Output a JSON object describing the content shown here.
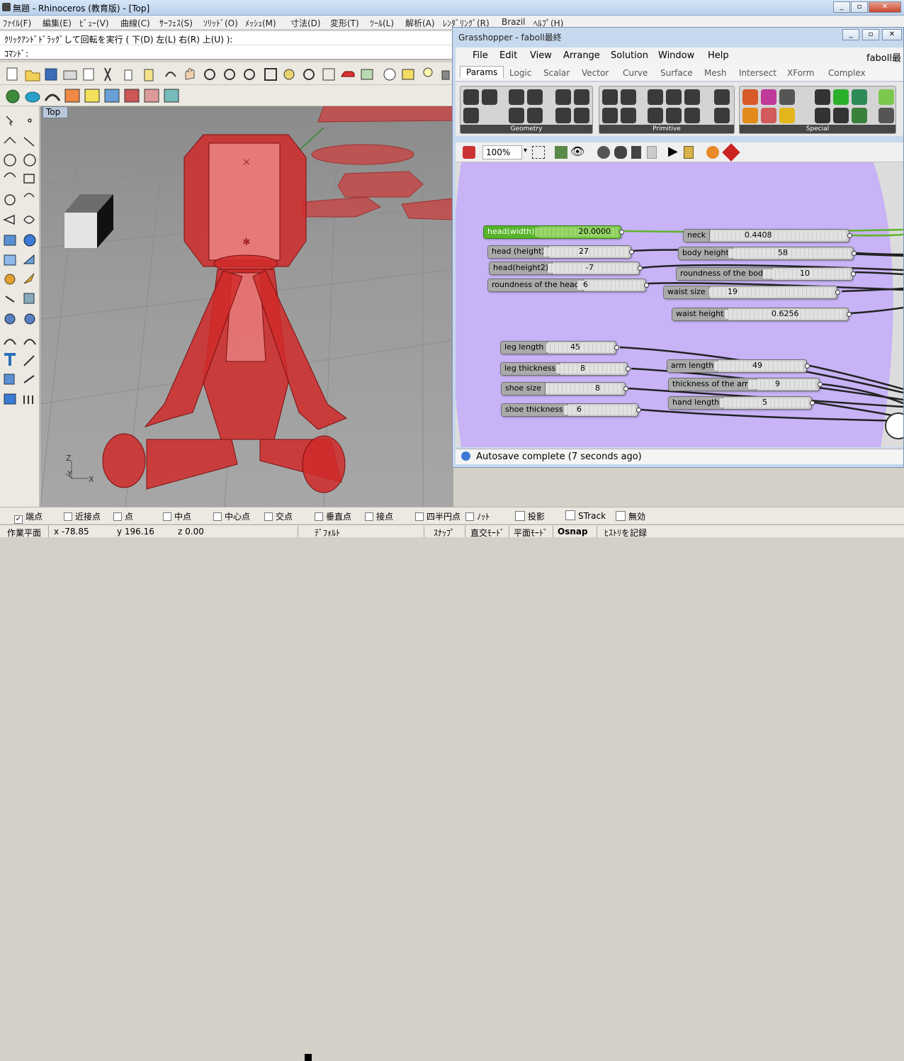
{
  "rhino": {
    "title": "無題 - Rhinoceros (教育版) - [Top]",
    "menus": [
      "ﾌｧｲﾙ(F)",
      "編集(E)",
      "ﾋﾞｭｰ(V)",
      "曲線(C)",
      "ｻｰﾌｪｽ(S)",
      "ｿﾘｯﾄﾞ(O)",
      "ﾒｯｼｭ(M)",
      "寸法(D)",
      "変形(T)",
      "ﾂｰﾙ(L)",
      "解析(A)",
      "ﾚﾝﾀﾞﾘﾝｸﾞ(R)",
      "Brazil",
      "ﾍﾙﾌﾟ(H)"
    ],
    "command_history": "ｸﾘｯｸｱﾝﾄﾞﾄﾞﾗｯｸﾞして回転を実行 ( 下(D)  左(L)  右(R)  上(U) ):",
    "command_prompt": "ｺﾏﾝﾄﾞ:",
    "viewport_name": "Top",
    "axis_labels": {
      "z": "Z",
      "y": "Y",
      "x": "X"
    }
  },
  "osnap": {
    "items": [
      {
        "label": "端点",
        "checked": true
      },
      {
        "label": "近接点",
        "checked": false
      },
      {
        "label": "点",
        "checked": false
      },
      {
        "label": "中点",
        "checked": false
      },
      {
        "label": "中心点",
        "checked": false
      },
      {
        "label": "交点",
        "checked": false
      },
      {
        "label": "垂直点",
        "checked": false
      },
      {
        "label": "接点",
        "checked": false
      },
      {
        "label": "四半円点",
        "checked": false
      },
      {
        "label": "ﾉｯﾄ",
        "checked": false
      }
    ],
    "extras": [
      "投影",
      "STrack",
      "無効"
    ]
  },
  "status": {
    "plane": "作業平面",
    "x": "x -78.85",
    "y": "y 196.16",
    "z": "z 0.00",
    "layer": "ﾃﾞﾌｫﾙﾄ",
    "snap": "ｽﾅｯﾌﾟ",
    "ortho": "直交ﾓｰﾄﾞ",
    "planar": "平面ﾓｰﾄﾞ",
    "osnap": "Osnap",
    "history": "ﾋｽﾄﾘを記録"
  },
  "gh": {
    "title": "Grasshopper - faboll最終",
    "doc_name": "faboll最終",
    "menus": [
      "File",
      "Edit",
      "View",
      "Arrange",
      "Solution",
      "Window",
      "Help"
    ],
    "tabs": [
      "Params",
      "Logic",
      "Scalar",
      "Vector",
      "Curve",
      "Surface",
      "Mesh",
      "Intersect",
      "XForm",
      "Complex"
    ],
    "groups": [
      "Geometry",
      "Primitive",
      "Special"
    ],
    "zoom": "100%",
    "status": "Autosave complete (7 seconds ago)",
    "sliders": [
      {
        "label": "head(width)",
        "value": "20.0000",
        "active": true
      },
      {
        "label": "head (height)",
        "value": "27"
      },
      {
        "label": "head(height2)",
        "value": "-7"
      },
      {
        "label": "roundness of the head",
        "value": "6"
      },
      {
        "label": "neck",
        "value": "0.4408"
      },
      {
        "label": "body height",
        "value": "58"
      },
      {
        "label": "roundness of the body",
        "value": "10"
      },
      {
        "label": "waist size",
        "value": "19"
      },
      {
        "label": "waist height",
        "value": "0.6256"
      },
      {
        "label": "leg length",
        "value": "45"
      },
      {
        "label": "leg thickness",
        "value": "8"
      },
      {
        "label": "shoe size",
        "value": "8"
      },
      {
        "label": "shoe thickness",
        "value": "6"
      },
      {
        "label": "arm length",
        "value": "49"
      },
      {
        "label": "thickness of the arm",
        "value": "9"
      },
      {
        "label": "hand length",
        "value": "5"
      }
    ]
  }
}
